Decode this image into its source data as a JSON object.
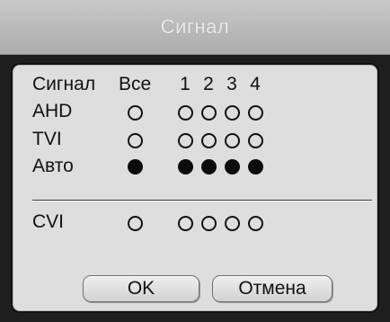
{
  "dialog": {
    "title": "Сигнал"
  },
  "table": {
    "header": {
      "row_label": "Сигнал",
      "all": "Все",
      "channels": [
        "1",
        "2",
        "3",
        "4"
      ]
    },
    "rows": [
      {
        "label": "AHD",
        "all": false,
        "channels": [
          false,
          false,
          false,
          false
        ]
      },
      {
        "label": "TVI",
        "all": false,
        "channels": [
          false,
          false,
          false,
          false
        ]
      },
      {
        "label": "Авто",
        "all": true,
        "channels": [
          true,
          true,
          true,
          true
        ]
      },
      {
        "label": "CVI",
        "all": false,
        "channels": [
          false,
          false,
          false,
          false
        ]
      }
    ]
  },
  "buttons": {
    "ok": "OK",
    "cancel": "Отмена"
  }
}
